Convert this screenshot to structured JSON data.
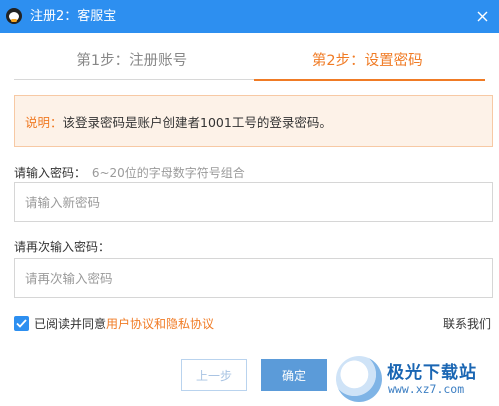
{
  "window": {
    "title": "注册2：客服宝"
  },
  "tabs": [
    {
      "label": "第1步：注册账号"
    },
    {
      "label": "第2步：设置密码"
    }
  ],
  "notice": {
    "label": "说明：",
    "text": "该登录密码是账户创建者1001工号的登录密码。"
  },
  "password": {
    "label": "请输入密码：",
    "hint": "6~20位的字母数字符号组合",
    "placeholder": "请输入新密码",
    "value": ""
  },
  "confirm": {
    "label": "请再次输入密码：",
    "placeholder": "请再次输入密码",
    "value": ""
  },
  "agreement": {
    "checked": true,
    "text": "已阅读并同意",
    "link": "用户协议和隐私协议"
  },
  "contact": {
    "label": "联系我们"
  },
  "buttons": {
    "prev": "上一步",
    "ok": "确定"
  },
  "watermark": {
    "title": "极光下载站",
    "url": "www.xz7.com"
  },
  "colors": {
    "titlebar": "#2d8ff0",
    "accent": "#f07b25",
    "primary_button": "#5b9bd9"
  }
}
